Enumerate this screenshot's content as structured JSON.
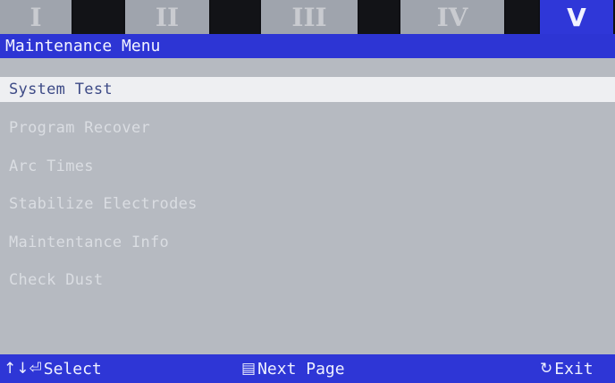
{
  "tabs": [
    "I",
    "II",
    "III",
    "IV",
    "V"
  ],
  "active_tab": "V",
  "title": "Maintenance Menu",
  "menu": {
    "items": [
      "System Test",
      "Program Recover",
      "Arc Times",
      "Stabilize Electrodes",
      "Maintentance Info",
      "Check Dust"
    ],
    "selected": "System Test"
  },
  "footer": {
    "select_icon": "↑↓⏎",
    "select_label": "Select",
    "next_icon": "▤",
    "next_label": "Next Page",
    "exit_icon": "↻",
    "exit_label": "Exit"
  },
  "colors": {
    "accent": "#2e36d6",
    "background": "#b6bac1",
    "selected_row": "#eeeff2"
  }
}
